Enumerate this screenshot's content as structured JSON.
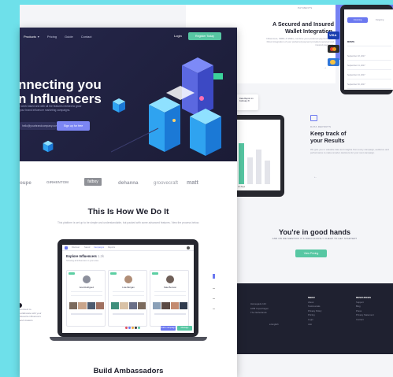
{
  "nav": {
    "items": [
      "Products",
      "Pricing",
      "Guide",
      "Contact"
    ],
    "login": "Login",
    "register": "Register Today"
  },
  "hero": {
    "title_line1": "nnecting you",
    "title_line2": "n Influencers",
    "subtitle": "r work based and with all the features needed to grow your brand influencer marketing campaigns.",
    "email_placeholder": "hello@yourbrandcompany.com",
    "signup": "Sign up for free"
  },
  "logos": [
    "oupe",
    "GIRHENTOM",
    "fatboy",
    "dehanna",
    "groovecraft",
    "matt"
  ],
  "how": {
    "title": "This Is How We Do It",
    "subtitle": "This platform is set up to be simple and understandable, but packed with some advanced features. View the process below."
  },
  "dashboard": {
    "tabs": [
      "Discover",
      "Saved",
      "Campaigns",
      "Reports"
    ],
    "title": "Explore Influencers",
    "count": "1.2k",
    "filter_text": "Showing all influencers in your area",
    "cards": [
      {
        "name": "Ana Rodriguez"
      },
      {
        "name": "Lisa Morgan"
      },
      {
        "name": "Kate Benson"
      }
    ],
    "btn_primary": "Add to campaign",
    "btn_secondary": "Message"
  },
  "side_note": "Connect to collaborate with your favourite influencers and creators",
  "bottom_section": {
    "title": "Build Ambassadors"
  },
  "payments": {
    "eyebrow": "PAYMENTS",
    "title_line1": "A Secured and Insured",
    "title_line2": "Wallet Integration.",
    "subtitle": "Influencers, SMBs & SMEs, combine your preferred payment tools. Direct integration of your preferred payment providers secured and insured payments."
  },
  "phone": {
    "tabs": [
      "Incoming",
      "Outgoing"
    ],
    "rows": [
      "September 18, 2017",
      "September 21, 2017",
      "September 24, 2017",
      "September 30, 2017",
      "Today"
    ],
    "header": "MONTH"
  },
  "reports": {
    "eyebrow": "DATA REPORTS",
    "title_line1": "Keep track of",
    "title_line2": "your Results",
    "subtitle": "We give you in valuable data and insights from every campaign, audience and performance to make smarter decisions for your next campaign.",
    "chart_label": "14 days",
    "float_label": "Data Report on February 8"
  },
  "good_hands": {
    "title": "You're in good hands",
    "subtitle": "AND ON WE MENTION IT'S RIDICULOUSLY CHEAP TO GET STARTED?",
    "button": "View Pricing"
  },
  "footer": {
    "address": [
      "Havnegade 12C",
      "1058 Copenhagen",
      "The Netherlands"
    ],
    "menu_title": "MENU",
    "menu": [
      "About",
      "Testimonials",
      "Privacy Policy",
      "Pricing",
      "Login",
      "Join"
    ],
    "resources_title": "RESOURCES",
    "resources": [
      "Support",
      "Blog",
      "Press",
      "",
      "Privacy Statement",
      "Contact"
    ],
    "language": "English"
  },
  "colors": {
    "accent": "#6b78f0",
    "green": "#57c7a3",
    "hero_bg": "#25264a"
  }
}
